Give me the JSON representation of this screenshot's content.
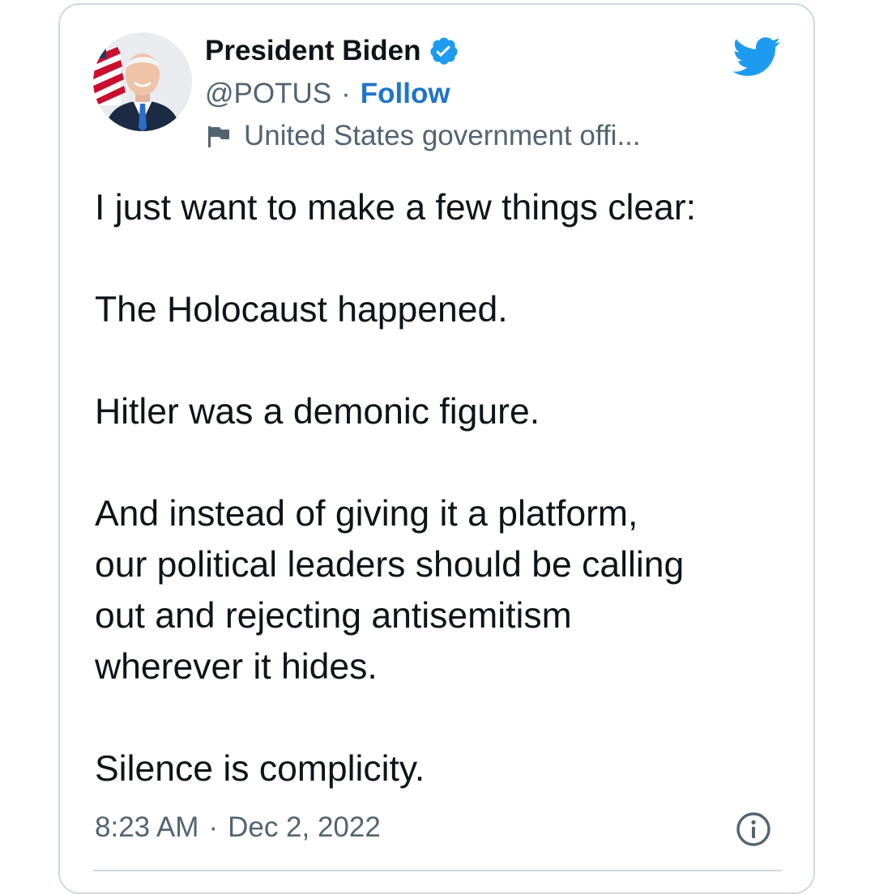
{
  "author": {
    "name": "President Biden",
    "handle": "@POTUS",
    "separator": "·",
    "follow_label": "Follow",
    "label": "United States government offi...",
    "verified_icon": "verified-badge-icon",
    "avatar": "profile-photo"
  },
  "tweet": {
    "paragraphs": [
      [
        "I just want to make a few things clear:"
      ],
      [
        "The Holocaust happened."
      ],
      [
        "Hitler was a demonic figure."
      ],
      [
        "And instead of giving it a platform,",
        "our political leaders should be calling",
        "out and rejecting antisemitism",
        "wherever it hides."
      ],
      [
        "Silence is complicity."
      ]
    ]
  },
  "meta": {
    "time": "8:23 AM",
    "separator": "·",
    "date": "Dec 2, 2022"
  },
  "colors": {
    "twitter_blue": "#1d9bf0",
    "follow_blue": "#1d75c9",
    "text": "#0f1419",
    "secondary": "#536471",
    "border": "#cfd9de"
  }
}
